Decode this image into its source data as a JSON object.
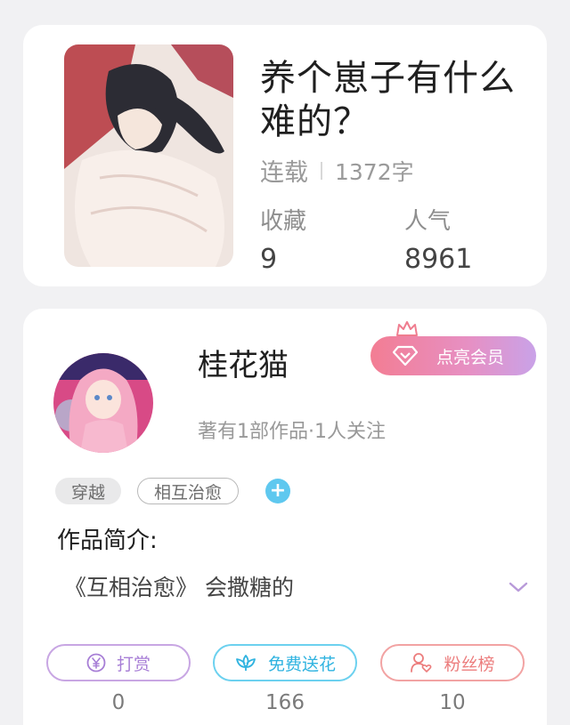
{
  "book": {
    "title": "养个崽子有什么难的？",
    "status": "连载",
    "word_count": "1372字",
    "favorites_label": "收藏",
    "favorites_value": "9",
    "popularity_label": "人气",
    "popularity_value": "8961"
  },
  "author": {
    "name": "桂花猫",
    "meta": "著有1部作品·1人关注",
    "vip_button": "点亮会员"
  },
  "tags": {
    "filled": "穿越",
    "outline": "相互治愈",
    "add": "+"
  },
  "intro": {
    "title": "作品简介:",
    "text": "《互相治愈》 会撒糖的"
  },
  "actions": [
    {
      "label": "打赏",
      "count": "0"
    },
    {
      "label": "免费送花",
      "count": "166"
    },
    {
      "label": "粉丝榜",
      "count": "10"
    }
  ],
  "icons": {
    "vip": "gem-icon",
    "crown": "crown-icon",
    "reward": "yen-coin-icon",
    "flower": "lotus-icon",
    "fans": "user-heart-icon",
    "expand": "chevron-down-icon"
  },
  "colors": {
    "vip_gradient_start": "#f37d93",
    "vip_gradient_end": "#c9a2e8",
    "tag_add": "#5fc8ef",
    "reward": "#a77ed6",
    "flower": "#2fb3e0",
    "fans": "#ec7d7d"
  }
}
